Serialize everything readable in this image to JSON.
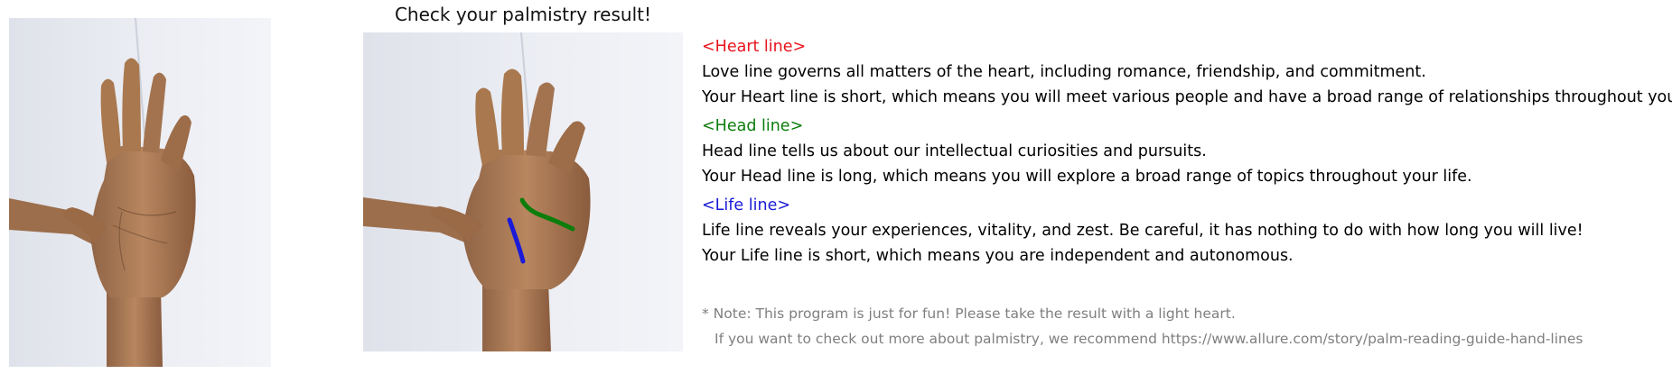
{
  "title": "Check your palmistry result!",
  "colors": {
    "heart": "#e8141c",
    "head": "#0b7d0b",
    "life": "#1a1ad8",
    "note": "#7f7f7f",
    "text": "#000000",
    "background": "#ffffff"
  },
  "images": {
    "original_hand": {
      "icon": "hand-photo-icon"
    },
    "analyzed_hand": {
      "icon": "hand-photo-annotated-icon"
    }
  },
  "sections": {
    "heart": {
      "heading": "<Heart line>",
      "description": "Love line governs all matters of the heart, including romance, friendship, and commitment.",
      "result": "Your Heart line is short, which means you will meet various people and have a broad range of relationships throughout your life."
    },
    "head": {
      "heading": "<Head line>",
      "description": "Head line tells us about our intellectual curiosities and pursuits.",
      "result": "Your Head line is long, which means you will explore a broad range of topics throughout your life."
    },
    "life": {
      "heading": "<Life line>",
      "description": "Life line reveals your experiences, vitality, and zest. Be careful, it has nothing to do with how long you will live!",
      "result": "Your Life line is short, which means you are independent and autonomous."
    }
  },
  "note": {
    "line1": "* Note: This program is just for fun! Please take the result with a light heart.",
    "line2": "If you want to check out more about palmistry, we recommend https://www.allure.com/story/palm-reading-guide-hand-lines"
  }
}
